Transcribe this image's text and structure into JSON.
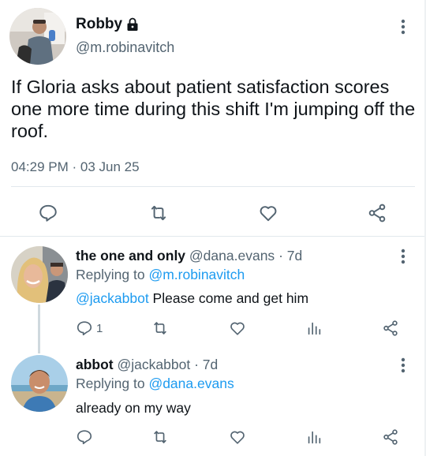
{
  "main_tweet": {
    "display_name": "Robby",
    "handle": "@m.robinavitch",
    "text": "If Gloria asks about patient satisfaction scores one more time during this shift I'm jumping off the roof.",
    "timestamp": "04:29 PM · 03 Jun 25"
  },
  "replies": [
    {
      "display_name": "the one and only",
      "handle": "@dana.evans",
      "age": "· 7d",
      "replying_label": "Replying to",
      "replying_to": "@m.robinavitch",
      "mention": "@jackabbot",
      "text": " Please come and get him",
      "reply_count": "1"
    },
    {
      "display_name": "abbot",
      "handle": "@jackabbot",
      "age": "· 7d",
      "replying_label": "Replying to",
      "replying_to": "@dana.evans",
      "text": "already on my way"
    }
  ],
  "colors": {
    "accent": "#1d9bf0",
    "muted": "#536471",
    "divider": "#e1e8ed"
  }
}
